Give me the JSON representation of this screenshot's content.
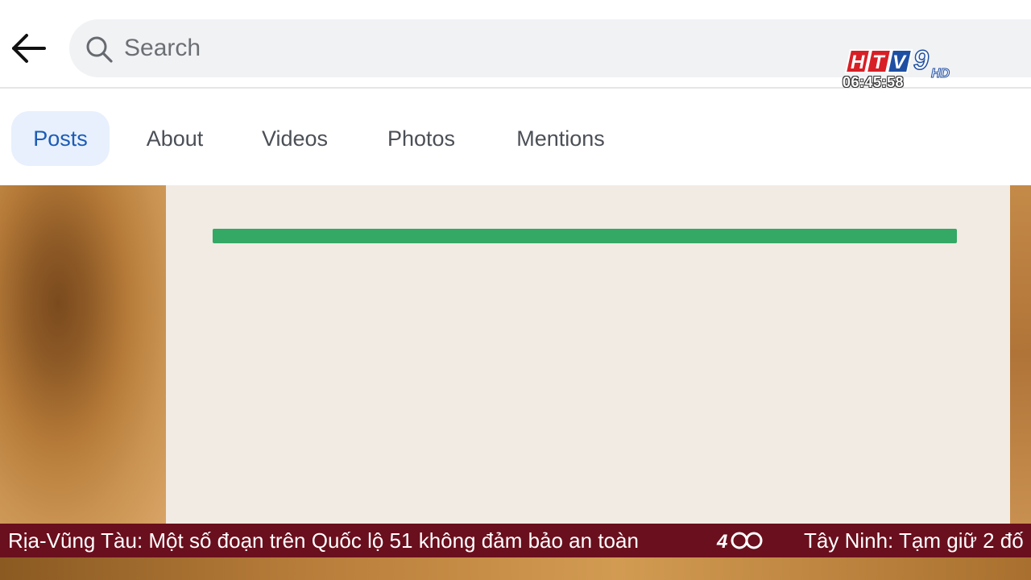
{
  "search": {
    "placeholder": "Search"
  },
  "tabs": [
    {
      "label": "Posts",
      "active": true
    },
    {
      "label": "About",
      "active": false
    },
    {
      "label": "Videos",
      "active": false
    },
    {
      "label": "Photos",
      "active": false
    },
    {
      "label": "Mentions",
      "active": false
    }
  ],
  "broadcast": {
    "channel_logo_text": "HTV9 HD",
    "clock": "06:45:58"
  },
  "ticker": {
    "headline_1": "Rịa-Vũng Tàu: Một số đoạn trên Quốc lộ 51 không đảm bảo an toàn",
    "headline_2": "Tây Ninh: Tạm giữ 2 đố"
  },
  "colors": {
    "accent": "#1c5bb5",
    "active_tab_bg": "#e7f0fc",
    "progress_bar": "#34a865",
    "ticker_bg": "#6a0f1d"
  },
  "icons": {
    "back": "arrow-left",
    "search": "magnifier"
  }
}
